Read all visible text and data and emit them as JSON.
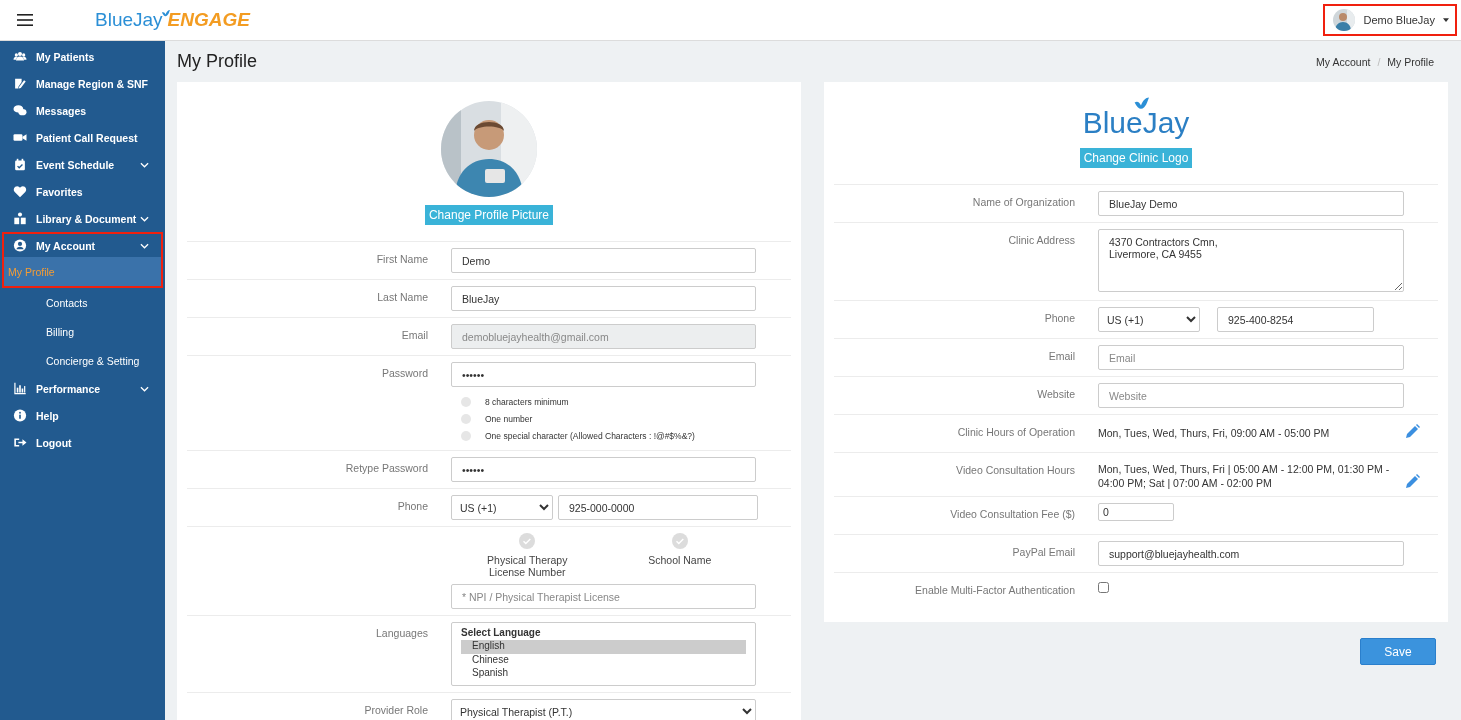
{
  "header": {
    "logo": {
      "primary": "BlueJay",
      "secondary": "ENGAGE"
    },
    "user_menu": {
      "name": "Demo BlueJay",
      "highlighted": true
    }
  },
  "sidebar": {
    "items": [
      {
        "label": "My Patients",
        "has_submenu": false,
        "selected": false,
        "highlighted": false
      },
      {
        "label": "Manage Region & SNF",
        "has_submenu": false,
        "selected": false,
        "highlighted": false
      },
      {
        "label": "Messages",
        "has_submenu": false,
        "selected": false,
        "highlighted": false
      },
      {
        "label": "Patient Call Request",
        "has_submenu": false,
        "selected": false,
        "highlighted": false
      },
      {
        "label": "Event Schedule",
        "has_submenu": true,
        "selected": false,
        "highlighted": false
      },
      {
        "label": "Favorites",
        "has_submenu": false,
        "selected": false,
        "highlighted": false
      },
      {
        "label": "Library & Document",
        "has_submenu": true,
        "selected": false,
        "highlighted": false
      },
      {
        "label": "My Account",
        "has_submenu": true,
        "selected": false,
        "highlighted": true,
        "children": [
          {
            "label": "My Profile",
            "selected": true
          },
          {
            "label": "Contacts",
            "selected": false
          },
          {
            "label": "Billing",
            "selected": false
          },
          {
            "label": "Concierge & Setting",
            "selected": false
          }
        ]
      },
      {
        "label": "Performance",
        "has_submenu": true,
        "selected": false,
        "highlighted": false
      },
      {
        "label": "Help",
        "has_submenu": false,
        "selected": false,
        "highlighted": false
      },
      {
        "label": "Logout",
        "has_submenu": false,
        "selected": false,
        "highlighted": false
      }
    ]
  },
  "page": {
    "title": "My Profile",
    "breadcrumb": {
      "items": [
        "My Account",
        "My Profile"
      ],
      "separator": "/"
    }
  },
  "profile_card": {
    "change_picture_button": "Change Profile Picture",
    "fields": [
      {
        "label": "First Name",
        "kind": "text",
        "value": "Demo"
      },
      {
        "label": "Last Name",
        "kind": "text",
        "value": "BlueJay"
      },
      {
        "label": "Email",
        "kind": "text",
        "value": "demobluejayhealth@gmail.com",
        "disabled": true
      },
      {
        "label": "Password",
        "kind": "password",
        "value": "••••••",
        "hints": [
          {
            "text": "8 characters minimum",
            "met": false
          },
          {
            "text": "One number",
            "met": false
          },
          {
            "text": "One special character (Allowed Characters : !@#$%&?)",
            "met": false
          }
        ]
      },
      {
        "label": "Retype Password",
        "kind": "password",
        "value": "••••••"
      },
      {
        "label": "Phone",
        "kind": "phone",
        "country": "US (+1)",
        "value": "925-000-0000"
      },
      {
        "kind": "license",
        "steps": [
          {
            "label": "Physical Therapy License Number",
            "completed": false
          },
          {
            "label": "School Name",
            "completed": false
          }
        ],
        "placeholder": "* NPI / Physical Therapist License"
      },
      {
        "label": "Languages",
        "kind": "listbox",
        "header": "Select Language",
        "options": [
          {
            "label": "English",
            "selected": true
          },
          {
            "label": "Chinese",
            "selected": false
          },
          {
            "label": "Spanish",
            "selected": false
          }
        ]
      },
      {
        "label": "Provider Role",
        "kind": "select",
        "value": "Physical Therapist (P.T.)"
      }
    ]
  },
  "clinic_card": {
    "logo": {
      "text": "BlueJay"
    },
    "change_logo_button": "Change Clinic Logo",
    "fields": [
      {
        "label": "Name of Organization",
        "kind": "text",
        "value": "BlueJay Demo"
      },
      {
        "label": "Clinic Address",
        "kind": "textarea",
        "value": "4370 Contractors Cmn,\nLivermore, CA 9455"
      },
      {
        "label": "Phone",
        "kind": "phone",
        "country": "US (+1)",
        "value": "925-400-8254"
      },
      {
        "label": "Email",
        "kind": "text",
        "placeholder": "Email"
      },
      {
        "label": "Website",
        "kind": "text",
        "placeholder": "Website"
      },
      {
        "label": "Clinic Hours of Operation",
        "kind": "schedule",
        "value": "Mon, Tues, Wed, Thurs, Fri, 09:00 AM - 05:00 PM"
      },
      {
        "label": "Video Consultation Hours",
        "kind": "schedule",
        "value": "Mon, Tues, Wed, Thurs, Fri | 05:00 AM - 12:00 PM, 01:30 PM - 04:00 PM; Sat | 07:00 AM - 02:00 PM"
      },
      {
        "label": "Video Consultation Fee ($)",
        "kind": "small",
        "value": "0"
      },
      {
        "label": "PayPal Email",
        "kind": "text",
        "value": "support@bluejayhealth.com"
      },
      {
        "label": "Enable Multi-Factor Authentication",
        "kind": "checkbox",
        "checked": false
      }
    ]
  },
  "save_button": "Save"
}
